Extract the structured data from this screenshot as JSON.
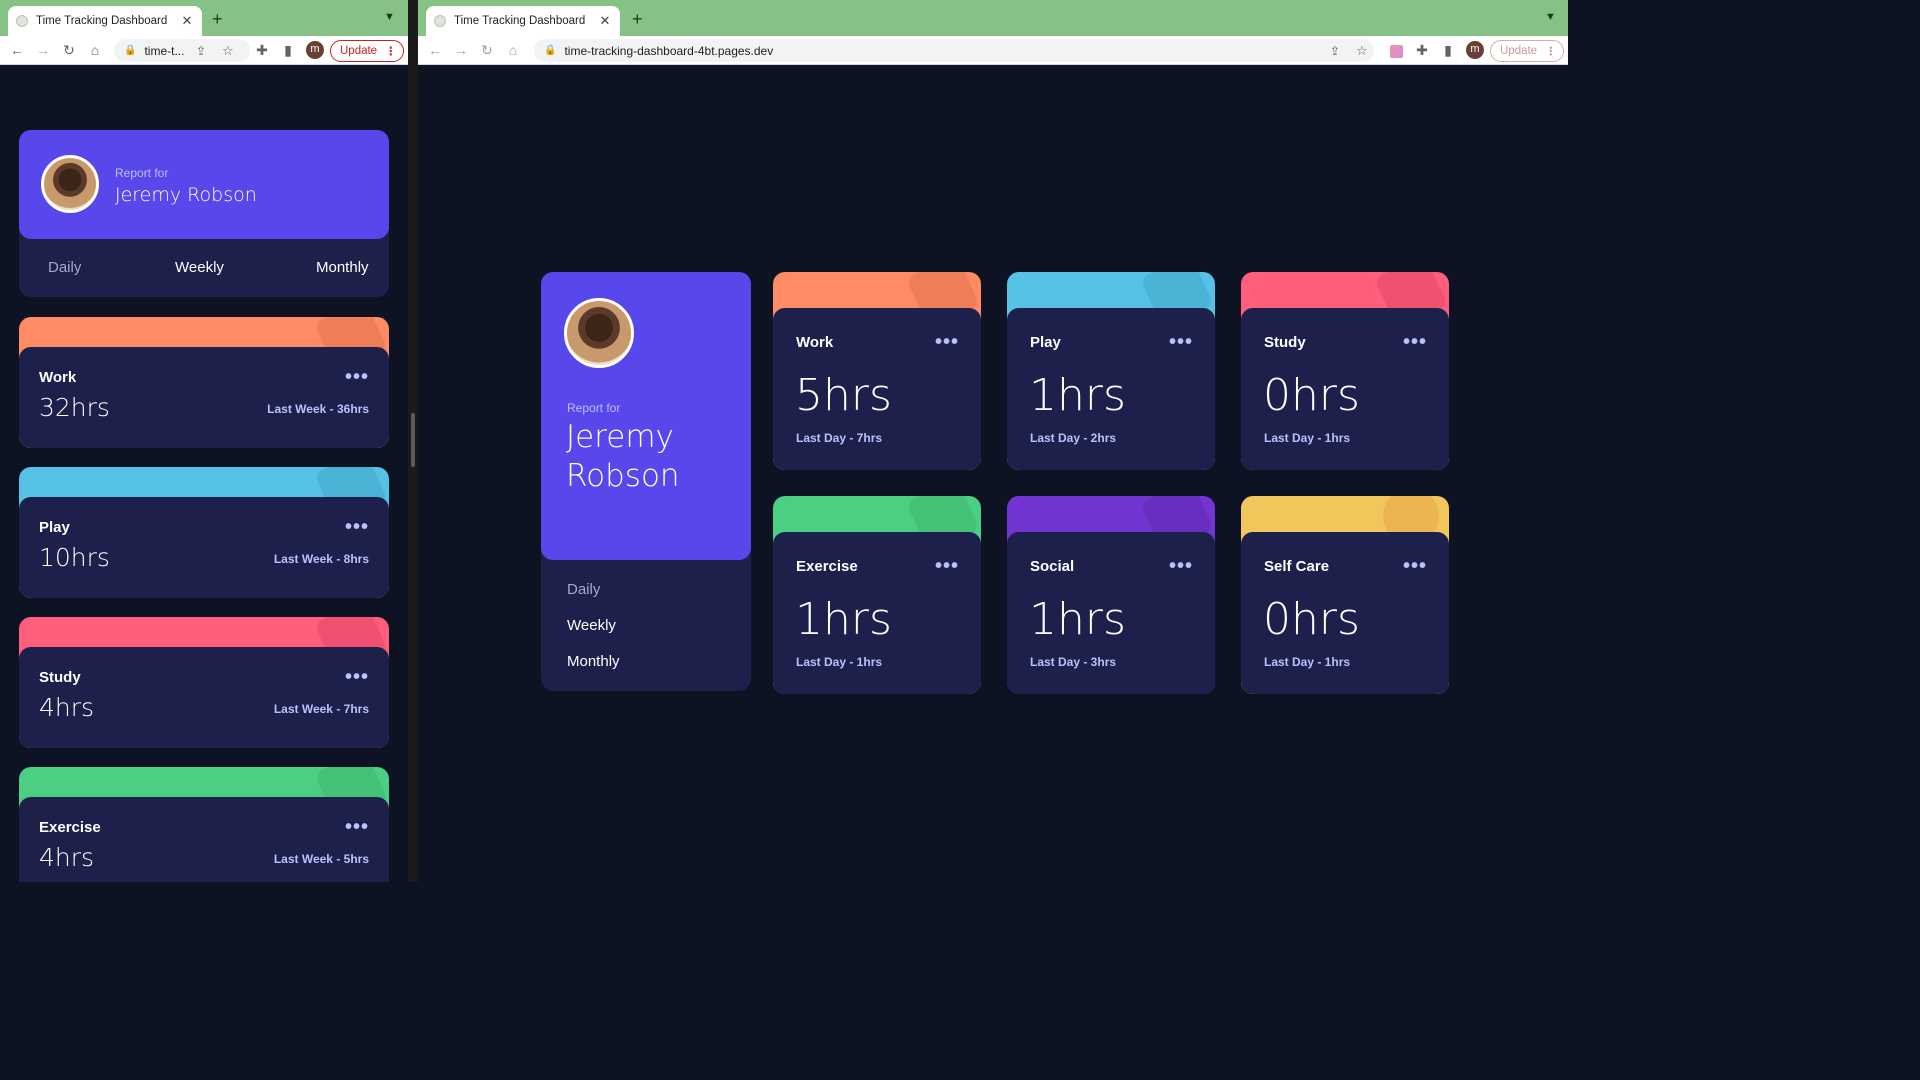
{
  "colors": {
    "work": "#ff8b64",
    "play": "#55c2e6",
    "study": "#ff5e7d",
    "exercise": "#4bcf82",
    "social": "#7335d2",
    "self_care": "#f1c75b",
    "profile": "#5847eb",
    "card": "#1c204b",
    "page": "#0e1323"
  },
  "left_window": {
    "tab_title": "Time Tracking Dashboard",
    "url": "time-t...",
    "profile_initial": "m",
    "update_label": "Update",
    "report_for": "Report for",
    "name": "Jeremy Robson",
    "periods": [
      "Daily",
      "Weekly",
      "Monthly"
    ],
    "active_period": "Weekly",
    "activities": [
      {
        "title": "Work",
        "current": "32hrs",
        "previous": "Last Week - 36hrs",
        "icon": "briefcase-icon",
        "color": "#ff8b64"
      },
      {
        "title": "Play",
        "current": "10hrs",
        "previous": "Last Week - 8hrs",
        "icon": "gamepad-icon",
        "color": "#55c2e6"
      },
      {
        "title": "Study",
        "current": "4hrs",
        "previous": "Last Week - 7hrs",
        "icon": "book-icon",
        "color": "#ff5e7d"
      },
      {
        "title": "Exercise",
        "current": "4hrs",
        "previous": "Last Week - 5hrs",
        "icon": "running-icon",
        "color": "#4bcf82"
      }
    ]
  },
  "right_window": {
    "tab_title": "Time Tracking Dashboard",
    "url": "time-tracking-dashboard-4bt.pages.dev",
    "profile_initial": "m",
    "update_label": "Update",
    "report_for": "Report for",
    "name_first": "Jeremy",
    "name_last": "Robson",
    "periods": [
      "Daily",
      "Weekly",
      "Monthly"
    ],
    "active_period": "Daily",
    "activities": [
      {
        "title": "Work",
        "current": "5hrs",
        "previous": "Last Day - 7hrs",
        "icon": "briefcase-icon",
        "color": "#ff8b64"
      },
      {
        "title": "Play",
        "current": "1hrs",
        "previous": "Last Day - 2hrs",
        "icon": "gamepad-icon",
        "color": "#55c2e6"
      },
      {
        "title": "Study",
        "current": "0hrs",
        "previous": "Last Day - 1hrs",
        "icon": "book-icon",
        "color": "#ff5e7d"
      },
      {
        "title": "Exercise",
        "current": "1hrs",
        "previous": "Last Day - 1hrs",
        "icon": "running-icon",
        "color": "#4bcf82"
      },
      {
        "title": "Social",
        "current": "1hrs",
        "previous": "Last Day - 3hrs",
        "icon": "chat-bubble-icon",
        "color": "#7335d2"
      },
      {
        "title": "Self Care",
        "current": "0hrs",
        "previous": "Last Day - 1hrs",
        "icon": "heart-icon",
        "color": "#f1c75b"
      }
    ]
  }
}
